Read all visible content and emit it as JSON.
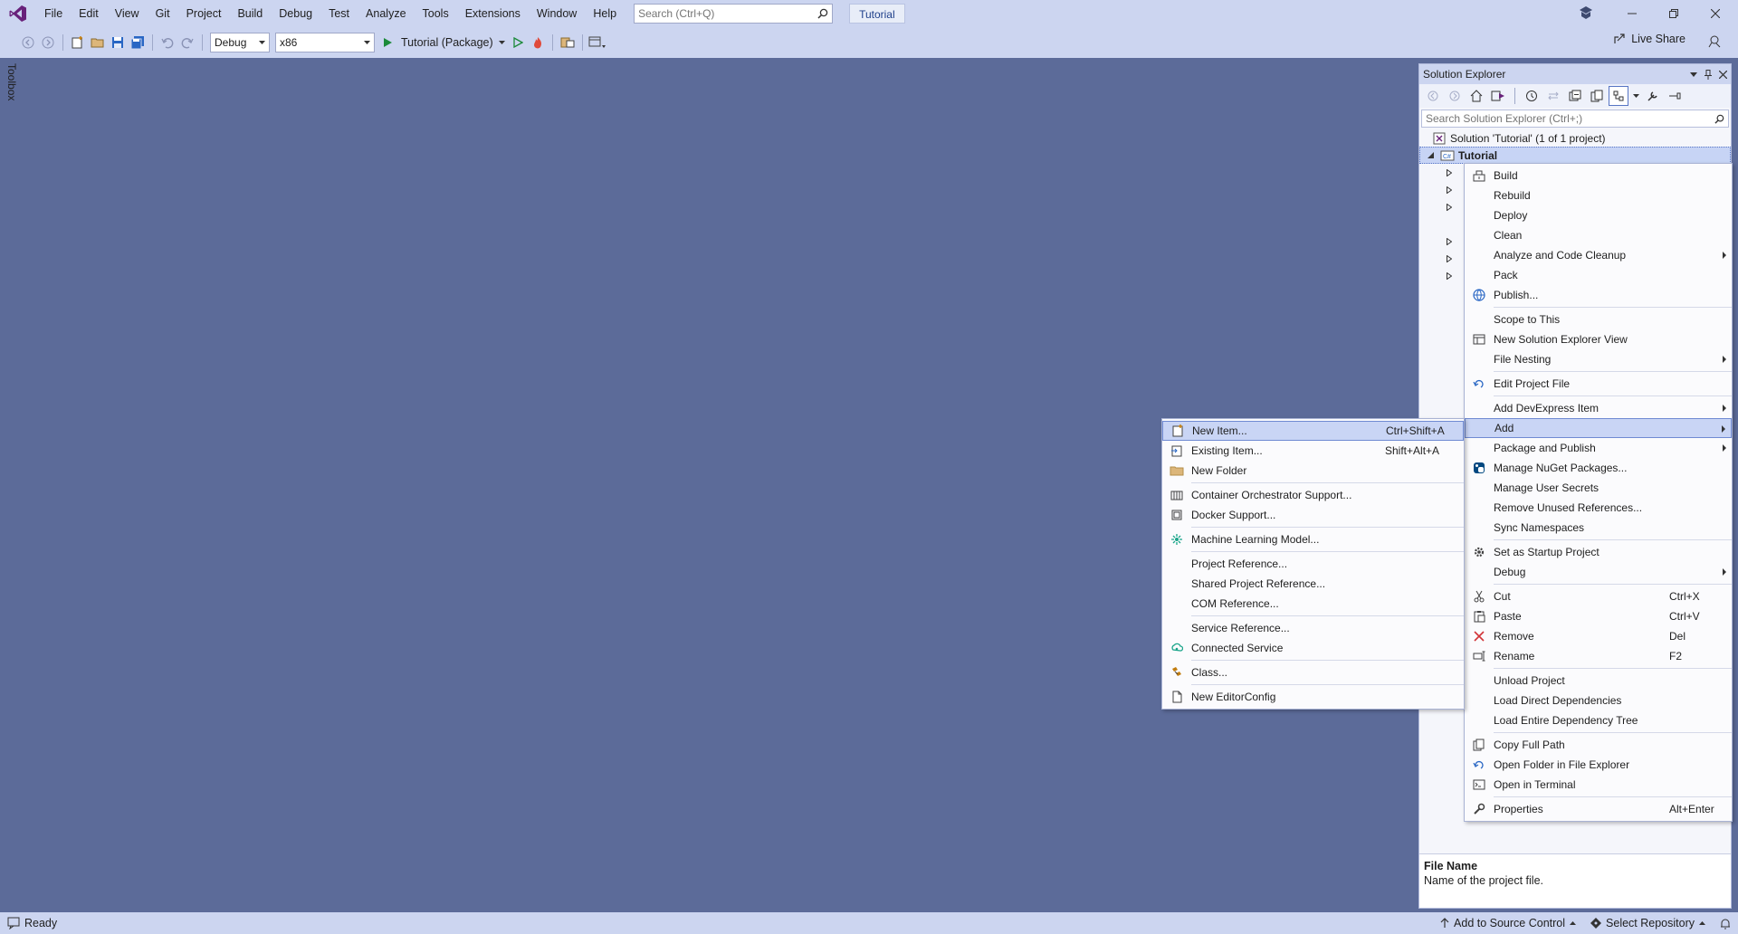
{
  "menubar": {
    "items": [
      "File",
      "Edit",
      "View",
      "Git",
      "Project",
      "Build",
      "Debug",
      "Test",
      "Analyze",
      "Tools",
      "Extensions",
      "Window",
      "Help"
    ],
    "search_placeholder": "Search (Ctrl+Q)",
    "solution_name": "Tutorial"
  },
  "toolbar": {
    "config": "Debug",
    "platform": "x86",
    "run_target": "Tutorial (Package)",
    "live_share": "Live Share"
  },
  "toolbox": {
    "label": "Toolbox"
  },
  "solution_explorer": {
    "title": "Solution Explorer",
    "search_placeholder": "Search Solution Explorer (Ctrl+;)",
    "solution_label": "Solution 'Tutorial' (1 of 1 project)",
    "project_label": "Tutorial",
    "properties": {
      "name": "File Name",
      "description": "Name of the project file."
    }
  },
  "project_menu": {
    "items": [
      {
        "label": "Build",
        "icon": "build-icon"
      },
      {
        "label": "Rebuild"
      },
      {
        "label": "Deploy"
      },
      {
        "label": "Clean"
      },
      {
        "label": "Analyze and Code Cleanup",
        "submenu": true
      },
      {
        "label": "Pack"
      },
      {
        "label": "Publish...",
        "icon": "publish-icon"
      },
      {
        "sep": true
      },
      {
        "label": "Scope to This"
      },
      {
        "label": "New Solution Explorer View",
        "icon": "new-view-icon"
      },
      {
        "label": "File Nesting",
        "submenu": true
      },
      {
        "sep": true
      },
      {
        "label": "Edit Project File",
        "icon": "edit-file-icon"
      },
      {
        "sep": true
      },
      {
        "label": "Add DevExpress Item",
        "submenu": true
      },
      {
        "label": "Add",
        "submenu": true,
        "highlight": true
      },
      {
        "label": "Package and Publish",
        "submenu": true
      },
      {
        "label": "Manage NuGet Packages...",
        "icon": "nuget-icon"
      },
      {
        "label": "Manage User Secrets"
      },
      {
        "label": "Remove Unused References..."
      },
      {
        "label": "Sync Namespaces"
      },
      {
        "sep": true
      },
      {
        "label": "Set as Startup Project",
        "icon": "gear-icon"
      },
      {
        "label": "Debug",
        "submenu": true
      },
      {
        "sep": true
      },
      {
        "label": "Cut",
        "shortcut": "Ctrl+X",
        "icon": "cut-icon"
      },
      {
        "label": "Paste",
        "shortcut": "Ctrl+V",
        "icon": "paste-icon"
      },
      {
        "label": "Remove",
        "shortcut": "Del",
        "icon": "remove-icon"
      },
      {
        "label": "Rename",
        "shortcut": "F2",
        "icon": "rename-icon"
      },
      {
        "sep": true
      },
      {
        "label": "Unload Project"
      },
      {
        "label": "Load Direct Dependencies"
      },
      {
        "label": "Load Entire Dependency Tree"
      },
      {
        "sep": true
      },
      {
        "label": "Copy Full Path",
        "icon": "copy-icon"
      },
      {
        "label": "Open Folder in File Explorer",
        "icon": "open-folder-icon"
      },
      {
        "label": "Open in Terminal",
        "icon": "terminal-icon"
      },
      {
        "sep": true
      },
      {
        "label": "Properties",
        "shortcut": "Alt+Enter",
        "icon": "wrench-icon"
      }
    ]
  },
  "add_menu": {
    "items": [
      {
        "label": "New Item...",
        "shortcut": "Ctrl+Shift+A",
        "icon": "new-item-icon",
        "highlight": true
      },
      {
        "label": "Existing Item...",
        "shortcut": "Shift+Alt+A",
        "icon": "existing-item-icon"
      },
      {
        "label": "New Folder",
        "icon": "folder-icon"
      },
      {
        "sep": true
      },
      {
        "label": "Container Orchestrator Support...",
        "icon": "container-icon"
      },
      {
        "label": "Docker Support...",
        "icon": "docker-icon"
      },
      {
        "sep": true
      },
      {
        "label": "Machine Learning Model...",
        "icon": "ml-model-icon"
      },
      {
        "sep": true
      },
      {
        "label": "Project Reference..."
      },
      {
        "label": "Shared Project Reference..."
      },
      {
        "label": "COM Reference..."
      },
      {
        "sep": true
      },
      {
        "label": "Service Reference..."
      },
      {
        "label": "Connected Service",
        "icon": "connected-service-icon"
      },
      {
        "sep": true
      },
      {
        "label": "Class...",
        "icon": "class-icon"
      },
      {
        "sep": true
      },
      {
        "label": "New EditorConfig",
        "icon": "editorconfig-icon"
      }
    ]
  },
  "statusbar": {
    "ready": "Ready",
    "add_source_control": "Add to Source Control",
    "select_repository": "Select Repository"
  }
}
